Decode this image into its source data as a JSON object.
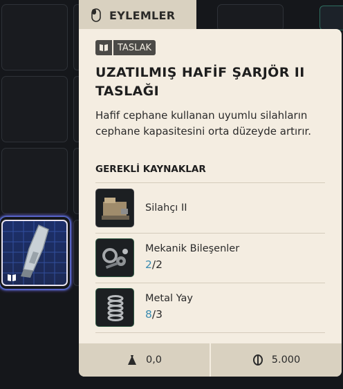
{
  "actions_tab": {
    "label": "EYLEMLER",
    "icon": "mouse-icon"
  },
  "tooltip": {
    "tag": {
      "icon": "book-icon",
      "label": "TASLAK"
    },
    "title": "UZATILMIŞ HAFİF ŞARJÖR II TASLAĞI",
    "description": "Hafif cephane kullanan uyumlu silahların cephane kapasitesini orta düzeyde artırır.",
    "required_title": "GEREKLİ KAYNAKLAR",
    "resources": [
      {
        "name": "Silahçı II",
        "icon": "gunsmith-bench-icon"
      },
      {
        "name": "Mekanik Bileşenler",
        "have": "2",
        "need": "/2",
        "icon": "mechanical-parts-icon"
      },
      {
        "name": "Metal Yay",
        "have": "8",
        "need": "/3",
        "icon": "metal-spring-icon"
      }
    ],
    "footer": {
      "weight": {
        "icon": "weight-icon",
        "value": "0,0"
      },
      "value": {
        "icon": "coin-icon",
        "value": "5.000"
      }
    }
  },
  "inventory": {
    "selected_item": {
      "icon": "magazine-blueprint-icon",
      "badge_icon": "book-icon"
    }
  },
  "colors": {
    "tooltip_bg": "#f4ede1",
    "tab_bg": "#d9d1c0",
    "have_count": "#3a8bb0",
    "item_bg": "#1c2f6a"
  }
}
